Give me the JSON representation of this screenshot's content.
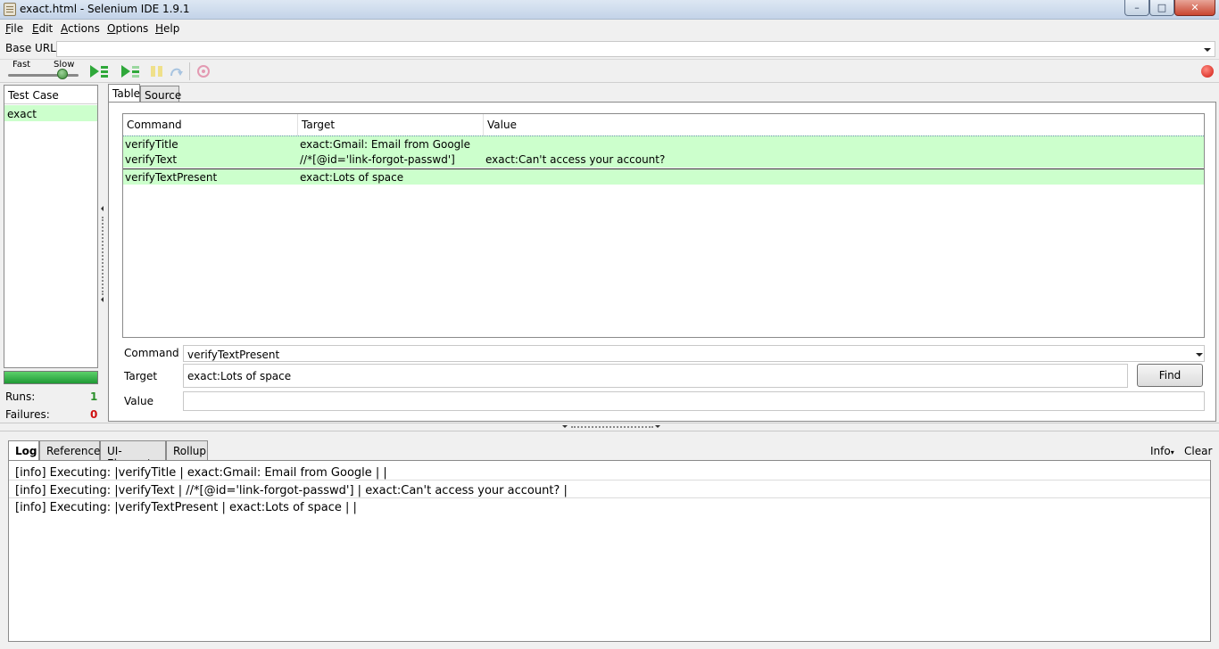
{
  "window": {
    "title": "exact.html - Selenium IDE 1.9.1"
  },
  "menu": [
    {
      "label": "File",
      "mnemonic": "F",
      "rest": "ile"
    },
    {
      "label": "Edit",
      "mnemonic": "E",
      "rest": "dit"
    },
    {
      "label": "Actions",
      "mnemonic": "A",
      "rest": "ctions"
    },
    {
      "label": "Options",
      "mnemonic": "O",
      "rest": "ptions"
    },
    {
      "label": "Help",
      "mnemonic": "H",
      "rest": "elp"
    }
  ],
  "base_url": {
    "label": "Base URL",
    "value": ""
  },
  "speed": {
    "fast_label": "Fast",
    "slow_label": "Slow"
  },
  "toolbar_icons": [
    "play-all-icon",
    "play-current-icon",
    "pause-icon",
    "step-icon",
    "rollup-icon",
    "record-icon"
  ],
  "testcases": {
    "header": "Test Case",
    "items": [
      "exact"
    ]
  },
  "stats": {
    "runs_label": "Runs:",
    "runs": "1",
    "failures_label": "Failures:",
    "failures": "0"
  },
  "editor": {
    "tabs": [
      "Table",
      "Source"
    ],
    "columns": [
      "Command",
      "Target",
      "Value"
    ],
    "rows": [
      {
        "command": "verifyTitle",
        "target": "exact:Gmail: Email from Google",
        "value": ""
      },
      {
        "command": "verifyText",
        "target": "//*[@id='link-forgot-passwd']",
        "value": "exact:Can't access your account?"
      },
      {
        "command": "verifyTextPresent",
        "target": "exact:Lots of space",
        "value": ""
      }
    ],
    "command_label": "Command",
    "command_value": "verifyTextPresent",
    "target_label": "Target",
    "target_value": "exact:Lots of space",
    "value_label": "Value",
    "value_value": "",
    "find_label": "Find"
  },
  "bottom": {
    "tabs": [
      "Log",
      "Reference",
      "UI-Element",
      "Rollup"
    ],
    "info_label": "Info",
    "clear_label": "Clear",
    "log": [
      "[info] Executing: |verifyTitle | exact:Gmail: Email from Google | |",
      "[info] Executing: |verifyText | //*[@id='link-forgot-passwd'] | exact:Can't access your account? |",
      "[info] Executing: |verifyTextPresent | exact:Lots of space | |"
    ]
  },
  "colors": {
    "pass_row": "#ccffcc",
    "runs_color": "#2a8f2a",
    "failures_color": "#d01010"
  }
}
